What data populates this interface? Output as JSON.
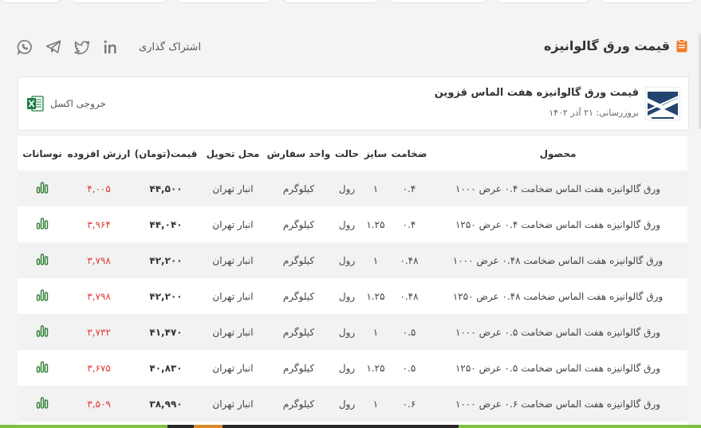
{
  "header": {
    "title": "قیمت ورق گالوانیزه",
    "share_label": "اشتراک گذاری",
    "share_icons": [
      "linkedin-icon",
      "twitter-icon",
      "telegram-icon",
      "whatsapp-icon"
    ]
  },
  "card": {
    "product_name": "قیمت ورق گالوانیزه هفت الماس قزوین",
    "updated": "بروزرسانی: ۲۱ آذر ۱۴۰۲",
    "excel_label": "خروجی اکسل"
  },
  "table": {
    "headers": {
      "product": "محصول",
      "thickness": "ضخامت",
      "size": "سایز",
      "state": "حالت",
      "unit": "واحد سفارش",
      "delivery": "محل تحویل",
      "price": "قیمت(تومان)",
      "vat": "ارزش افزوده",
      "fluctuation": "نوسانات"
    },
    "rows": [
      {
        "product": "ورق گالوانیزه هفت الماس ضخامت ۰.۴ عرض ۱۰۰۰",
        "thickness": "۰.۴",
        "size": "۱",
        "state": "رول",
        "unit": "کیلوگرم",
        "delivery": "انبار تهران",
        "price": "۴۴,۵۰۰",
        "vat": "۴,۰۰۵"
      },
      {
        "product": "ورق گالوانیزه هفت الماس ضخامت ۰.۴ عرض ۱۲۵۰",
        "thickness": "۰.۴",
        "size": "۱.۲۵",
        "state": "رول",
        "unit": "کیلوگرم",
        "delivery": "انبار تهران",
        "price": "۴۴,۰۴۰",
        "vat": "۳,۹۶۴"
      },
      {
        "product": "ورق گالوانیزه هفت الماس ضخامت ۰.۴۸ عرض ۱۰۰۰",
        "thickness": "۰.۴۸",
        "size": "۱",
        "state": "رول",
        "unit": "کیلوگرم",
        "delivery": "انبار تهران",
        "price": "۴۲,۲۰۰",
        "vat": "۳,۷۹۸"
      },
      {
        "product": "ورق گالوانیزه هفت الماس ضخامت ۰.۴۸ عرض ۱۲۵۰",
        "thickness": "۰.۴۸",
        "size": "۱.۲۵",
        "state": "رول",
        "unit": "کیلوگرم",
        "delivery": "انبار تهران",
        "price": "۴۲,۲۰۰",
        "vat": "۳,۷۹۸"
      },
      {
        "product": "ورق گالوانیزه هفت الماس ضخامت ۰.۵ عرض ۱۰۰۰",
        "thickness": "۰.۵",
        "size": "۱",
        "state": "رول",
        "unit": "کیلوگرم",
        "delivery": "انبار تهران",
        "price": "۴۱,۴۷۰",
        "vat": "۳,۷۳۲"
      },
      {
        "product": "ورق گالوانیزه هفت الماس ضخامت ۰.۵ عرض ۱۲۵۰",
        "thickness": "۰.۵",
        "size": "۱.۲۵",
        "state": "رول",
        "unit": "کیلوگرم",
        "delivery": "انبار تهران",
        "price": "۴۰,۸۳۰",
        "vat": "۳,۶۷۵"
      },
      {
        "product": "ورق گالوانیزه هفت الماس ضخامت ۰.۶ عرض ۱۰۰۰",
        "thickness": "۰.۶",
        "size": "۱",
        "state": "رول",
        "unit": "کیلوگرم",
        "delivery": "انبار تهران",
        "price": "۳۸,۹۹۰",
        "vat": "۳,۵۰۹"
      }
    ]
  },
  "colors": {
    "accent_orange": "#f07c22",
    "vat_red": "#e53935",
    "trend_green": "#2e7d32",
    "excel_green": "#1e7e45",
    "logo_navy": "#24456e"
  }
}
